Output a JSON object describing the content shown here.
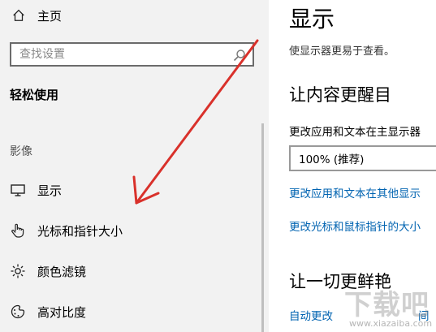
{
  "sidebar": {
    "home_label": "主页",
    "search_placeholder": "查找设置",
    "section_title": "轻松使用",
    "group_label": "影像",
    "items": [
      {
        "label": "显示",
        "icon": "monitor-icon"
      },
      {
        "label": "光标和指针大小",
        "icon": "pointer-hand-icon"
      },
      {
        "label": "颜色滤镜",
        "icon": "brightness-icon"
      },
      {
        "label": "高对比度",
        "icon": "contrast-icon"
      }
    ]
  },
  "main": {
    "title": "显示",
    "description": "使显示器更易于查看。",
    "section1_heading": "让内容更醒目",
    "text_size_label": "更改应用和文本在主显示器",
    "dropdown_value": "100% (推荐)",
    "link1": "更改应用和文本在其他显示",
    "link2": "更改光标和鼠标指针的大小",
    "section2_heading": "让一切更鲜艳",
    "link3": "自动更改",
    "link4": "间"
  },
  "annotation": {
    "color": "#d9312b"
  },
  "watermark": {
    "text": "下载吧",
    "url": "www.xiazaiba.com"
  }
}
